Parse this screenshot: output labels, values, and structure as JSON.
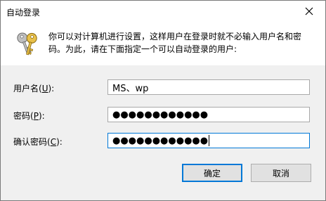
{
  "window": {
    "title": "自动登录"
  },
  "header": {
    "icon": "keys-icon",
    "text": "你可以对计算机进行设置，这样用户在登录时就不必输入用户名和密码。为此，请在下面指定一个可以自动登录的用户:"
  },
  "fields": {
    "username": {
      "label_prefix": "用户名(",
      "accel": "U",
      "label_suffix": "):",
      "value": "MS、wp"
    },
    "password": {
      "label_prefix": "密码(",
      "accel": "P",
      "label_suffix": "):",
      "value": "●●●●●●●●●●●●"
    },
    "confirm": {
      "label_prefix": "确认密码(",
      "accel": "C",
      "label_suffix": "):",
      "value": "●●●●●●●●●●●●"
    }
  },
  "buttons": {
    "ok": "确定",
    "cancel": "取消"
  }
}
